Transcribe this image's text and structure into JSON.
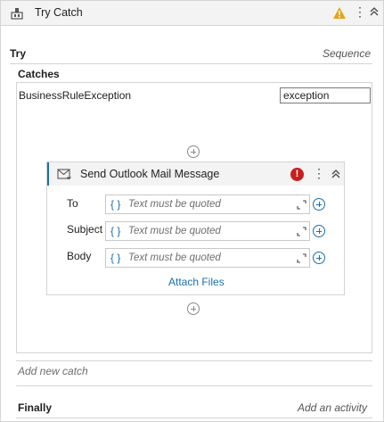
{
  "header": {
    "title": "Try Catch",
    "icons": [
      "try-catch-icon",
      "warning-icon",
      "more-options-icon",
      "collapse-icon"
    ],
    "warning_color": "#e8a317"
  },
  "try": {
    "label": "Try",
    "type": "Sequence"
  },
  "catches": {
    "label": "Catches",
    "items": [
      {
        "exception_type": "BusinessRuleException",
        "variable": "exception"
      }
    ]
  },
  "activity": {
    "title": "Send Outlook Mail Message",
    "icons": [
      "mail-icon",
      "error-icon",
      "more-options-icon",
      "collapse-icon"
    ],
    "error_glyph": "!",
    "error_color": "#c81e1e",
    "accent_color": "#1a6fb3",
    "fields": [
      {
        "label": "To",
        "placeholder": "Text must be quoted"
      },
      {
        "label": "Subject",
        "placeholder": "Text must be quoted"
      },
      {
        "label": "Body",
        "placeholder": "Text must be quoted"
      }
    ],
    "expression_glyph": "{ }",
    "attach_label": "Attach Files"
  },
  "add_catch_label": "Add new catch",
  "finally": {
    "label": "Finally",
    "add_label": "Add an activity"
  }
}
